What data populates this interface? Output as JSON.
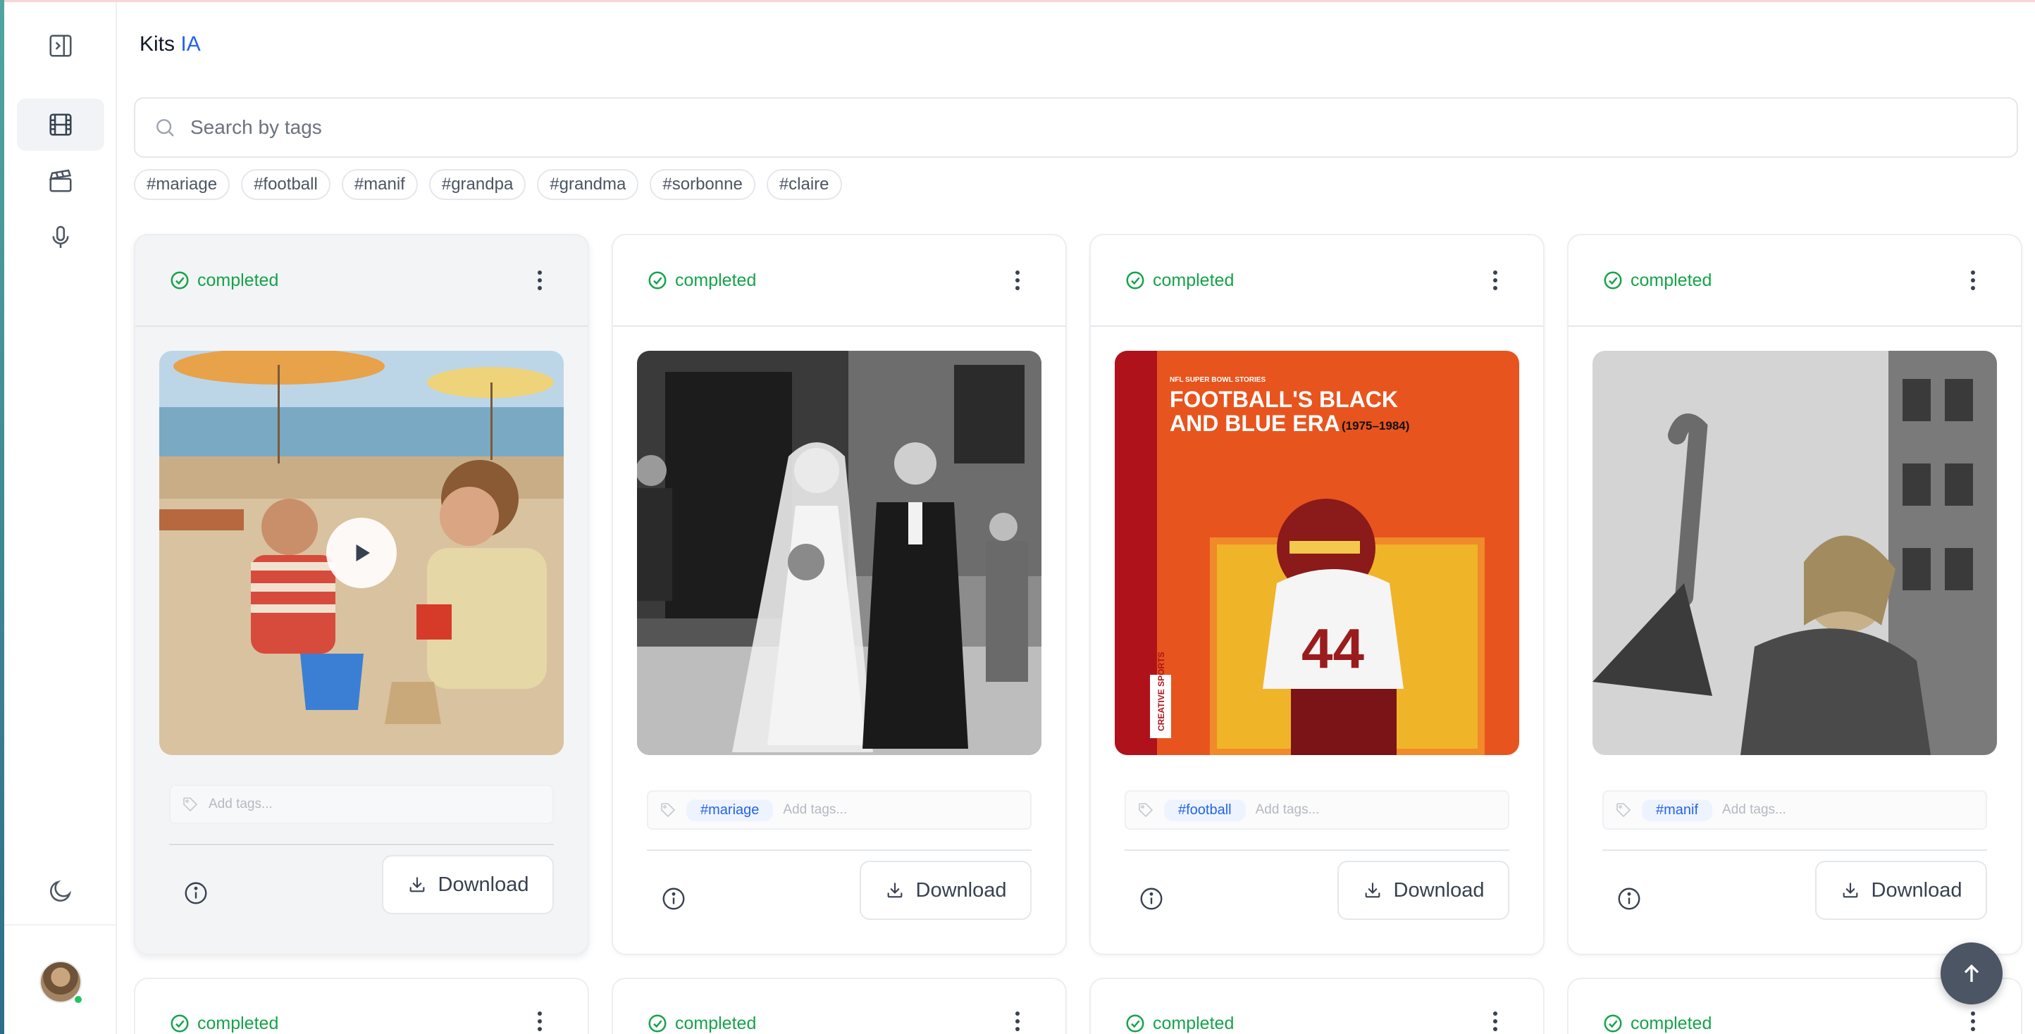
{
  "app": {
    "brand_prefix": "Kits",
    "brand_accent": "IA"
  },
  "search": {
    "placeholder": "Search by tags",
    "value": ""
  },
  "filter_tags": [
    "#mariage",
    "#football",
    "#manif",
    "#grandpa",
    "#grandma",
    "#sorbonne",
    "#claire"
  ],
  "cards": [
    {
      "status": "completed",
      "tag": "",
      "tag_placeholder": "Add tags...",
      "download_label": "Download",
      "media": "video-beach-children"
    },
    {
      "status": "completed",
      "tag": "#mariage",
      "tag_placeholder": "Add tags...",
      "download_label": "Download",
      "media": "photo-wedding"
    },
    {
      "status": "completed",
      "tag": "#football",
      "tag_placeholder": "Add tags...",
      "download_label": "Download",
      "media": "poster-football"
    },
    {
      "status": "completed",
      "tag": "#manif",
      "tag_placeholder": "Add tags...",
      "download_label": "Download",
      "media": "photo-protest"
    }
  ],
  "poster": {
    "kicker": "NFL SUPER BOWL STORIES",
    "title_line1": "FOOTBALL'S BLACK",
    "title_line2": "AND BLUE ERA",
    "years": "(1975–1984)",
    "publisher": "CREATIVE SPORTS"
  },
  "row2_statuses": [
    "completed",
    "completed",
    "completed",
    "completed"
  ],
  "colors": {
    "accent": "#2563eb",
    "status_green": "#16a34a",
    "scroll_button": "#4b5563"
  }
}
